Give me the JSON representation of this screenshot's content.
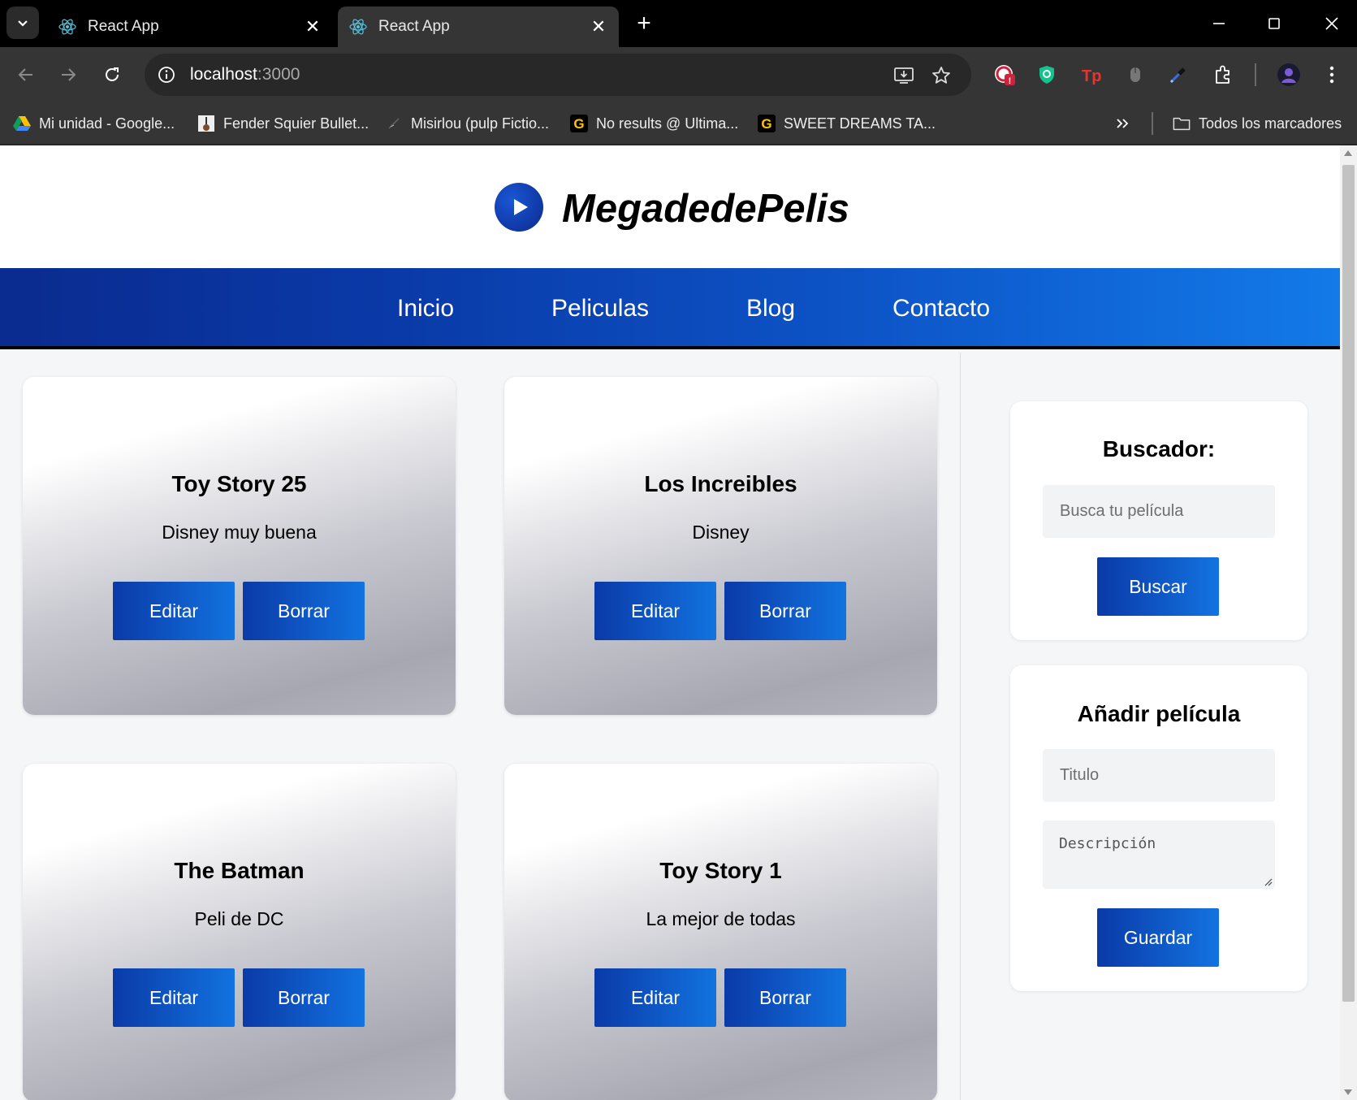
{
  "browser": {
    "tabs": [
      {
        "title": "React App",
        "active": false
      },
      {
        "title": "React App",
        "active": true
      }
    ],
    "url": {
      "host": "localhost",
      "port": ":3000"
    },
    "bookmarks": [
      {
        "label": "Mi unidad - Google...",
        "icon": "google-drive-icon"
      },
      {
        "label": "Fender Squier Bullet...",
        "icon": "guitar-icon"
      },
      {
        "label": "Misirlou (pulp Fictio...",
        "icon": "music-icon"
      },
      {
        "label": "No results @ Ultima...",
        "icon": "ultimate-guitar-icon"
      },
      {
        "label": "SWEET DREAMS TA...",
        "icon": "ultimate-guitar-icon"
      }
    ],
    "all_bookmarks_label": "Todos los marcadores"
  },
  "site": {
    "brand": "MegadedePelis",
    "nav": [
      "Inicio",
      "Peliculas",
      "Blog",
      "Contacto"
    ],
    "movies": [
      {
        "title": "Toy Story 25",
        "description": "Disney muy buena",
        "edit_label": "Editar",
        "delete_label": "Borrar"
      },
      {
        "title": "Los Increibles",
        "description": "Disney",
        "edit_label": "Editar",
        "delete_label": "Borrar"
      },
      {
        "title": "The Batman",
        "description": "Peli de DC",
        "edit_label": "Editar",
        "delete_label": "Borrar"
      },
      {
        "title": "Toy Story 1",
        "description": "La mejor de todas",
        "edit_label": "Editar",
        "delete_label": "Borrar"
      }
    ],
    "search": {
      "title": "Buscador:",
      "placeholder": "Busca tu película",
      "button": "Buscar"
    },
    "add_movie": {
      "title": "Añadir película",
      "title_placeholder": "Titulo",
      "description_placeholder": "Descripción",
      "button": "Guardar"
    }
  },
  "colors": {
    "nav_gradient_start": "#0a2b8f",
    "nav_gradient_end": "#137ae8",
    "button_gradient_start": "#0a3aa8",
    "button_gradient_end": "#1273e0"
  }
}
